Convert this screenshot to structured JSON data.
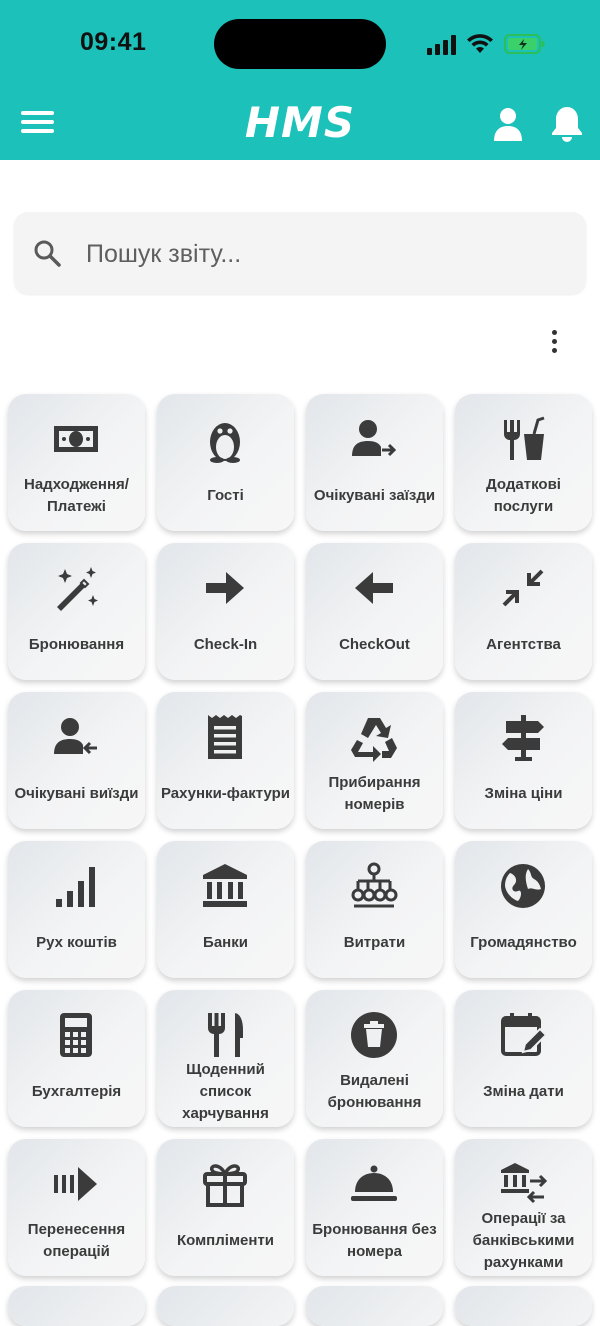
{
  "status_bar": {
    "time": "09:41"
  },
  "app_bar": {
    "logo": "HMS"
  },
  "search": {
    "placeholder": "Пошук звіту..."
  },
  "colors": {
    "header": "#1cc1b9",
    "icon": "#3b3b3b",
    "battery": "#3ad16b"
  },
  "tiles": [
    {
      "label": "Надходження/\nПлатежі",
      "icon": "money-icon"
    },
    {
      "label": "Гості",
      "icon": "penguin-icon"
    },
    {
      "label": "Очікувані заїзди",
      "icon": "user-arrow-in-icon"
    },
    {
      "label": "Додаткові послуги",
      "icon": "food-drink-icon"
    },
    {
      "label": "Бронювання",
      "icon": "magic-wand-icon"
    },
    {
      "label": "Check-In",
      "icon": "arrow-right-icon"
    },
    {
      "label": "CheckOut",
      "icon": "arrow-left-icon"
    },
    {
      "label": "Агентства",
      "icon": "compress-icon"
    },
    {
      "label": "Очікувані виїзди",
      "icon": "user-arrow-out-icon"
    },
    {
      "label": "Рахунки-фактури",
      "icon": "receipt-icon"
    },
    {
      "label": "Прибирання номерів",
      "icon": "recycle-icon"
    },
    {
      "label": "Зміна ціни",
      "icon": "signpost-icon"
    },
    {
      "label": "Рух коштів",
      "icon": "signal-bars-icon"
    },
    {
      "label": "Банки",
      "icon": "bank-icon"
    },
    {
      "label": "Витрати",
      "icon": "hierarchy-icon"
    },
    {
      "label": "Громадянство",
      "icon": "globe-icon"
    },
    {
      "label": "Бухгалтерія",
      "icon": "calculator-icon"
    },
    {
      "label": "Щоденний список харчування",
      "icon": "utensils-icon"
    },
    {
      "label": "Видалені бронювання",
      "icon": "trash-circle-icon"
    },
    {
      "label": "Зміна дати",
      "icon": "calendar-edit-icon"
    },
    {
      "label": "Перенесення операцій",
      "icon": "transfer-arrow-icon"
    },
    {
      "label": "Компліменти",
      "icon": "gift-icon"
    },
    {
      "label": "Бронювання без номера",
      "icon": "cloche-icon"
    },
    {
      "label": "Операції за банківськими рахунками",
      "icon": "bank-transfer-icon"
    }
  ]
}
